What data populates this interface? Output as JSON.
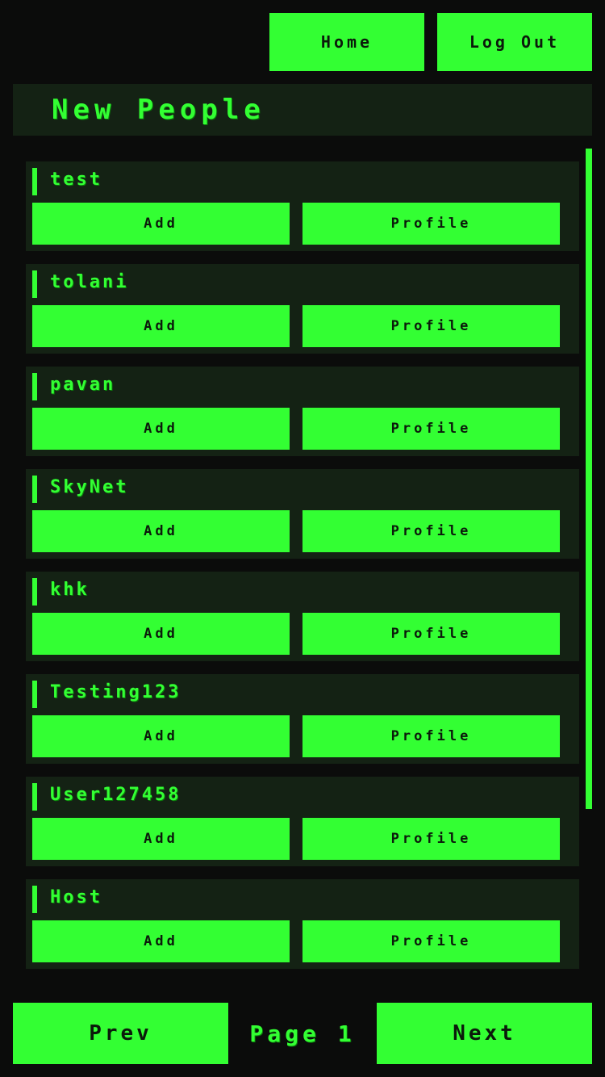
{
  "nav": {
    "home_label": "Home",
    "logout_label": "Log Out"
  },
  "page_title": "New People",
  "people": [
    {
      "name": "test",
      "add_label": "Add",
      "profile_label": "Profile"
    },
    {
      "name": "tolani",
      "add_label": "Add",
      "profile_label": "Profile"
    },
    {
      "name": "pavan",
      "add_label": "Add",
      "profile_label": "Profile"
    },
    {
      "name": "SkyNet",
      "add_label": "Add",
      "profile_label": "Profile"
    },
    {
      "name": "khk",
      "add_label": "Add",
      "profile_label": "Profile"
    },
    {
      "name": "Testing123",
      "add_label": "Add",
      "profile_label": "Profile"
    },
    {
      "name": "User127458",
      "add_label": "Add",
      "profile_label": "Profile"
    },
    {
      "name": "Host",
      "add_label": "Add",
      "profile_label": "Profile"
    }
  ],
  "pager": {
    "prev_label": "Prev",
    "page_label": "Page 1",
    "next_label": "Next"
  },
  "colors": {
    "accent": "#33ff33",
    "background": "#0b0c0b",
    "panel": "#142214"
  }
}
